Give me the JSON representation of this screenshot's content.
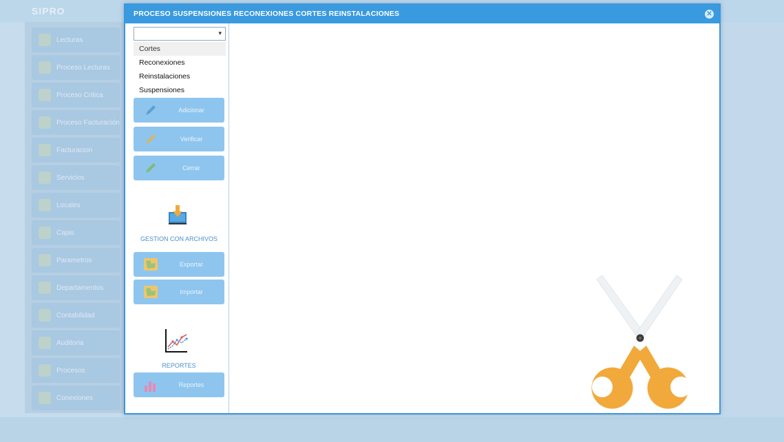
{
  "background_app": {
    "logo": "SIPRO",
    "menu_items": [
      {
        "label": "Lecturas"
      },
      {
        "label": "Proceso Lecturas"
      },
      {
        "label": "Proceso Critica"
      },
      {
        "label": "Proceso Facturación"
      },
      {
        "label": "Facturacion"
      },
      {
        "label": "Servicios"
      },
      {
        "label": "Locales"
      },
      {
        "label": "Cajas"
      },
      {
        "label": "Parametros"
      },
      {
        "label": "Departamentos"
      },
      {
        "label": "Contabilidad"
      },
      {
        "label": "Auditoria"
      },
      {
        "label": "Procesos"
      },
      {
        "label": "Conexiones"
      }
    ]
  },
  "dialog": {
    "title": "PROCESO SUSPENSIONES RECONEXIONES CORTES REINSTALACIONES",
    "close_icon": "close-circle-icon"
  },
  "sidebar": {
    "select": {
      "value": "",
      "options": [
        "Cortes",
        "Reconexiones",
        "Reinstalaciones",
        "Suspensiones"
      ],
      "highlighted": "Cortes"
    },
    "action_buttons": [
      {
        "label": "Adicionar",
        "icon": "pencil-icon",
        "color": "#4a90c8"
      },
      {
        "label": "Verificar",
        "icon": "pencil-icon",
        "color": "#e8b04a"
      },
      {
        "label": "Cerrar",
        "icon": "pencil-icon",
        "color": "#7cb85a"
      }
    ],
    "file_section": {
      "label": "GESTION CON ARCHIVOS",
      "icon": "download-tray-icon",
      "buttons": [
        {
          "label": "Exportar",
          "icon": "map-icon"
        },
        {
          "label": "Importar",
          "icon": "map-icon"
        }
      ]
    },
    "reports_section": {
      "label": "REPORTES",
      "icon": "line-chart-icon",
      "buttons": [
        {
          "label": "Reportes",
          "icon": "bar-chart-icon"
        }
      ]
    }
  },
  "main": {
    "illustration": "scissors-icon",
    "scissors_handle_color": "#f2a93b",
    "scissors_pivot_color": "#3c3c3c"
  }
}
